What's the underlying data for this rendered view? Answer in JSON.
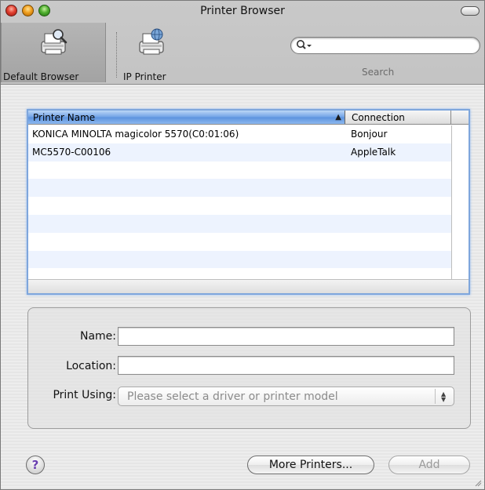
{
  "window": {
    "title": "Printer Browser"
  },
  "toolbar": {
    "items": [
      {
        "label": "Default Browser",
        "icon": "printer-magnifier-icon"
      },
      {
        "label": "IP Printer",
        "icon": "printer-globe-icon"
      }
    ],
    "search": {
      "placeholder": "",
      "label": "Search"
    }
  },
  "printer_table": {
    "columns": [
      {
        "label": "Printer Name",
        "sorted": "ascending"
      },
      {
        "label": "Connection"
      }
    ],
    "rows": [
      {
        "name": "KONICA MINOLTA magicolor 5570(C0:01:06)",
        "connection": "Bonjour"
      },
      {
        "name": "MC5570-C00106",
        "connection": "AppleTalk"
      }
    ]
  },
  "details": {
    "name_label": "Name:",
    "name_value": "",
    "location_label": "Location:",
    "location_value": "",
    "print_using_label": "Print Using:",
    "print_using_value": "Please select a driver or printer model"
  },
  "buttons": {
    "help": "?",
    "more_printers": "More Printers...",
    "add": "Add"
  },
  "colors": {
    "selection_header": "#6fa2e6",
    "alternate_row": "#edf3fe",
    "help_glyph": "#6a3fb0"
  }
}
